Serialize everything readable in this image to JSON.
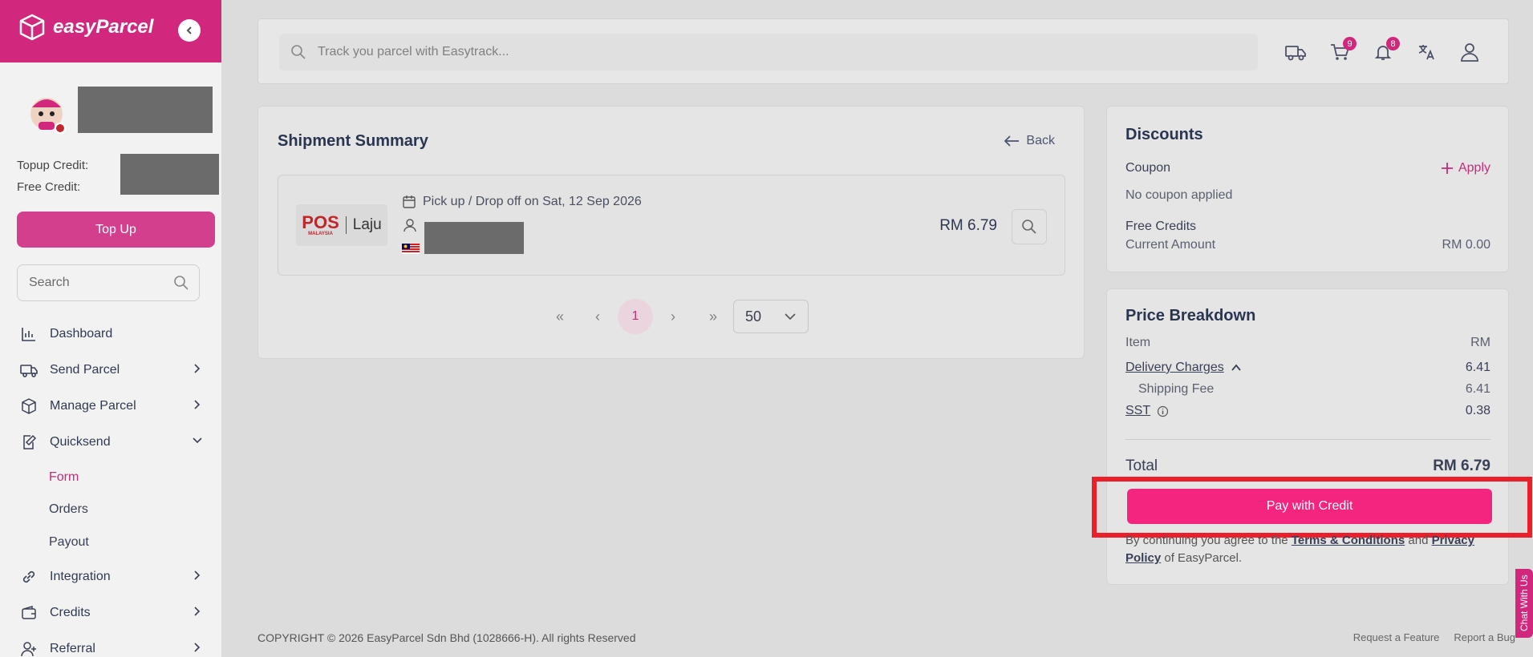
{
  "sidebar": {
    "brand": "easyParcel",
    "topup_credit_label": "Topup Credit:",
    "free_credit_label": "Free Credit:",
    "topup_button": "Top Up",
    "search_placeholder": "Search",
    "nav": [
      {
        "label": "Dashboard",
        "icon": "chart-icon"
      },
      {
        "label": "Send Parcel",
        "icon": "truck-icon"
      },
      {
        "label": "Manage Parcel",
        "icon": "box-icon"
      },
      {
        "label": "Quicksend",
        "icon": "edit-icon"
      },
      {
        "label": "Integration",
        "icon": "link-icon"
      },
      {
        "label": "Credits",
        "icon": "wallet-icon"
      },
      {
        "label": "Referral",
        "icon": "user-plus-icon"
      }
    ],
    "quicksend_sub": [
      "Form",
      "Orders",
      "Payout"
    ]
  },
  "topbar": {
    "track_placeholder": "Track you parcel with Easytrack...",
    "cart_count": "9",
    "notif_count": "8"
  },
  "summary": {
    "title": "Shipment Summary",
    "back_label": "Back",
    "courier_logo_main": "POS",
    "courier_logo_sub": "MALAYSIA",
    "courier_service": "Laju",
    "pickup_text": "Pick up / Drop off on Sat, 12 Sep 2026",
    "price": "RM 6.79",
    "current_page": "1",
    "per_page": "50"
  },
  "discounts": {
    "title": "Discounts",
    "coupon_label": "Coupon",
    "apply_label": "Apply",
    "no_coupon": "No coupon applied",
    "free_credits_label": "Free Credits",
    "current_amount_label": "Current Amount",
    "current_amount_value": "RM 0.00"
  },
  "breakdown": {
    "title": "Price Breakdown",
    "item_label": "Item",
    "item_unit": "RM",
    "delivery_label": "Delivery Charges",
    "delivery_value": "6.41",
    "shipping_label": "Shipping Fee",
    "shipping_value": "6.41",
    "sst_label": "SST",
    "sst_value": "0.38",
    "total_label": "Total",
    "total_value": "RM 6.79",
    "pay_button": "Pay with Credit",
    "terms_prefix": "By continuing you agree to the",
    "terms_link": "Terms & Conditions",
    "terms_and": "and",
    "privacy_link": "Privacy Policy",
    "terms_suffix": "of EasyParcel."
  },
  "footer": {
    "copyright": "COPYRIGHT © 2026 EasyParcel Sdn Bhd (1028666-H). All rights Reserved",
    "request_feature": "Request a Feature",
    "report_bug": "Report a Bug"
  },
  "chat_tab": "Chat With Us",
  "colors": {
    "brand": "#d1287d",
    "pay": "#f4257f",
    "highlight": "#ea1f2a"
  }
}
